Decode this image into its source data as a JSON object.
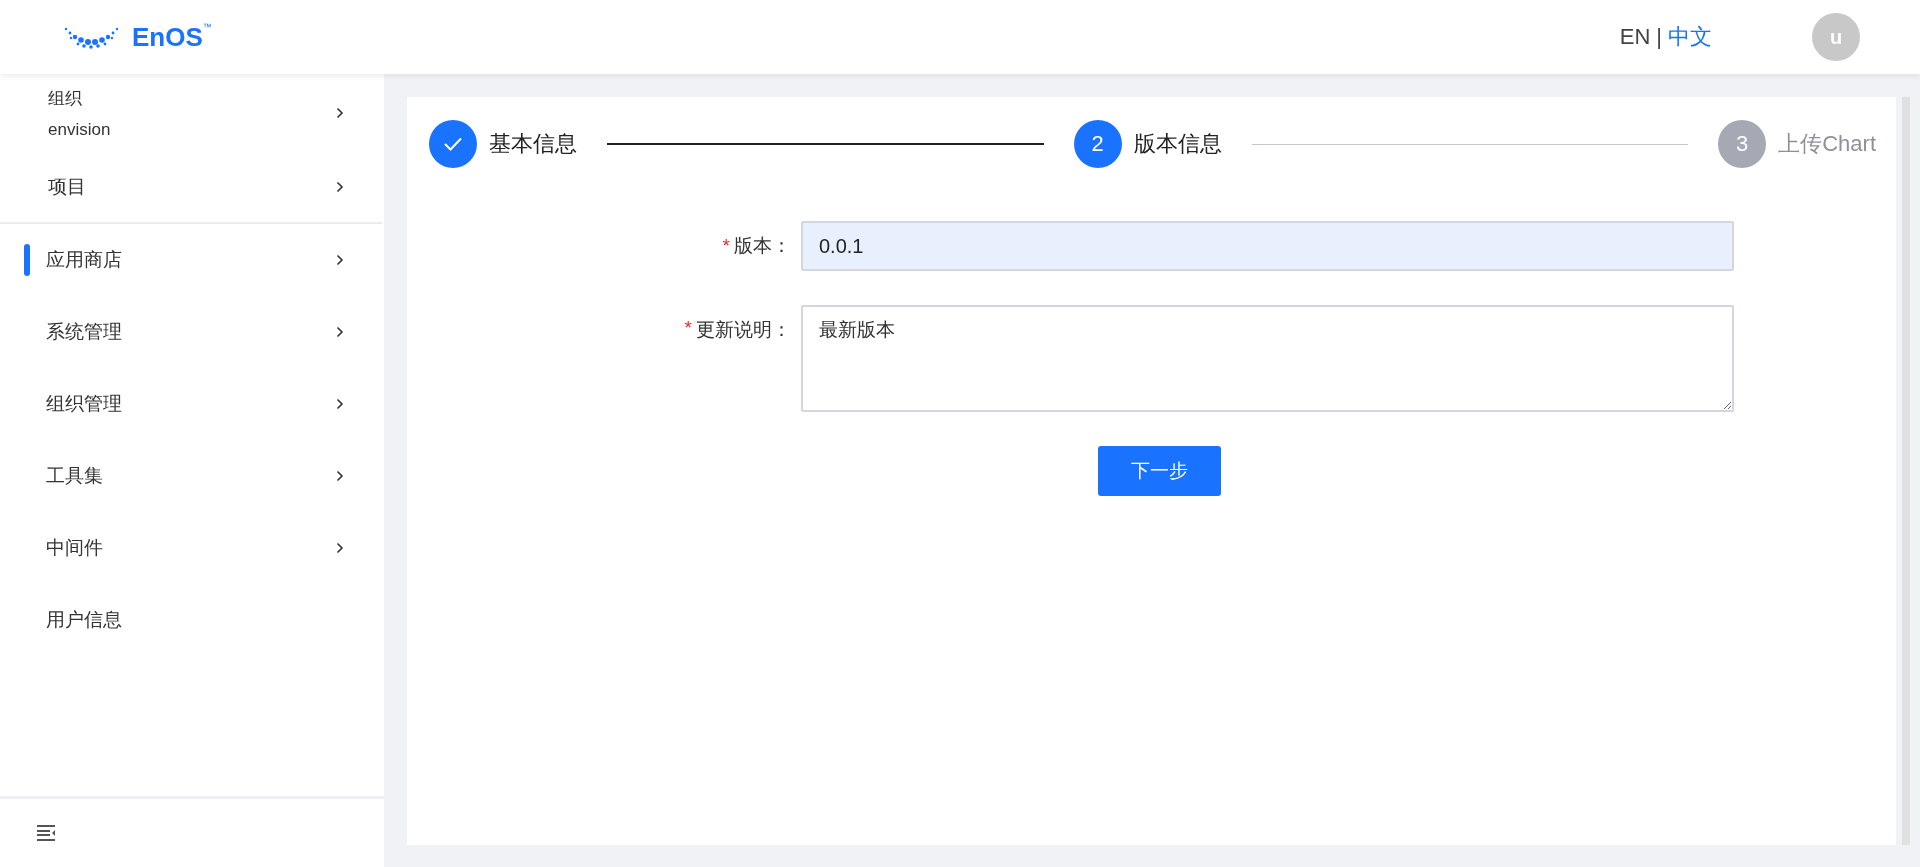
{
  "header": {
    "logo_text": "EnOS",
    "logo_mark": "™",
    "languages": [
      {
        "label": "EN",
        "selected": false
      },
      {
        "label": "中文",
        "selected": true
      }
    ],
    "language_separator": "|",
    "avatar_initial": "u"
  },
  "sidebar": {
    "org": {
      "label": "组织",
      "value": "envision"
    },
    "top_items": [
      {
        "label": "项目",
        "selected": false,
        "has_submenu": true
      }
    ],
    "items": [
      {
        "label": "应用商店",
        "selected": true,
        "has_submenu": true
      },
      {
        "label": "系统管理",
        "selected": false,
        "has_submenu": true
      },
      {
        "label": "组织管理",
        "selected": false,
        "has_submenu": true
      },
      {
        "label": "工具集",
        "selected": false,
        "has_submenu": true
      },
      {
        "label": "中间件",
        "selected": false,
        "has_submenu": true
      },
      {
        "label": "用户信息",
        "selected": false,
        "has_submenu": false
      }
    ]
  },
  "steps": [
    {
      "label": "基本信息",
      "kind": "done"
    },
    {
      "number": "2",
      "label": "版本信息",
      "kind": "active"
    },
    {
      "number": "3",
      "label": "上传Chart",
      "kind": "pending"
    }
  ],
  "form": {
    "fields": [
      {
        "label": "版本：",
        "required": true,
        "kind": "input",
        "value": "0.0.1"
      },
      {
        "label": "更新说明：",
        "required": true,
        "kind": "textarea",
        "value": "最新版本"
      }
    ],
    "required_mark": "*",
    "submit": "下一步"
  }
}
